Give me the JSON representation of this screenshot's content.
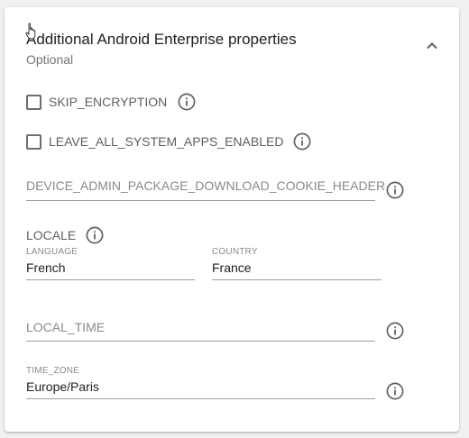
{
  "panel": {
    "title": "Additional Android Enterprise properties",
    "subtitle": "Optional"
  },
  "checkboxes": [
    {
      "label": "SKIP_ENCRYPTION",
      "checked": false
    },
    {
      "label": "LEAVE_ALL_SYSTEM_APPS_ENABLED",
      "checked": false
    }
  ],
  "fields": {
    "cookie_header": {
      "placeholder": "DEVICE_ADMIN_PACKAGE_DOWNLOAD_COOKIE_HEADER",
      "value": ""
    },
    "locale": {
      "label": "LOCALE",
      "language": {
        "label": "LANGUAGE",
        "value": "French"
      },
      "country": {
        "label": "COUNTRY",
        "value": "France"
      }
    },
    "local_time": {
      "placeholder": "LOCAL_TIME",
      "value": ""
    },
    "time_zone": {
      "label": "TIME_ZONE",
      "value": "Europe/Paris"
    }
  },
  "icons": {
    "collapse": "chevron-up-icon",
    "info": "info-icon"
  },
  "colors": {
    "icon": "#616161",
    "text_primary": "#212121",
    "text_secondary": "#757575",
    "underline": "#9e9e9e"
  }
}
